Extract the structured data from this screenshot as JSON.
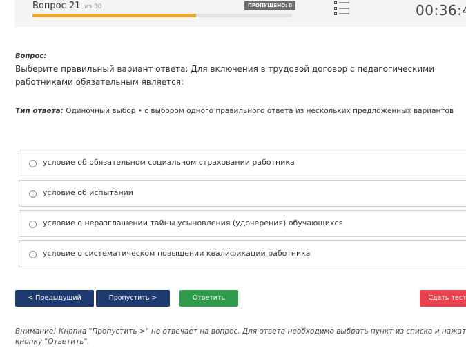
{
  "header": {
    "question_label": "Вопрос 21",
    "question_of": "из 30",
    "skipped_badge": "ПРОПУЩЕНО: 0",
    "progress_fraction": 0.63,
    "progress_color": "#e9a52e",
    "list_icon": "list-icon",
    "timer": "00:36:4"
  },
  "question": {
    "label": "Вопрос:",
    "text": "Выберите правильный вариант ответа: Для включения в трудовой договор с педагогическими работниками обязательным является:"
  },
  "answer_type": {
    "label": "Тип ответа:",
    "value": " Одиночный выбор • с выбором одного правильного ответа из нескольких предложенных вариантов"
  },
  "options": [
    {
      "label": "условие об обязательном социальном страховании работника"
    },
    {
      "label": "условие об испытании"
    },
    {
      "label": "условие о неразглашении тайны усыновления (удочерения) обучающихся"
    },
    {
      "label": "условие о систематическом повышении квалификации работника"
    }
  ],
  "buttons": {
    "prev": "< Предыдущий",
    "skip": "Пропустить >",
    "answer": "Ответить",
    "submit": "Сдать тест"
  },
  "colors": {
    "nav_blue": "#1e3a6e",
    "answer_green": "#2e9a4a",
    "submit_red": "#e8424f"
  },
  "warning": "Внимание! Кнопка \"Пропустить >\" не отвечает на вопрос. Для ответа необходимо выбрать пункт из списка и нажать кнопку \"Ответить\"."
}
